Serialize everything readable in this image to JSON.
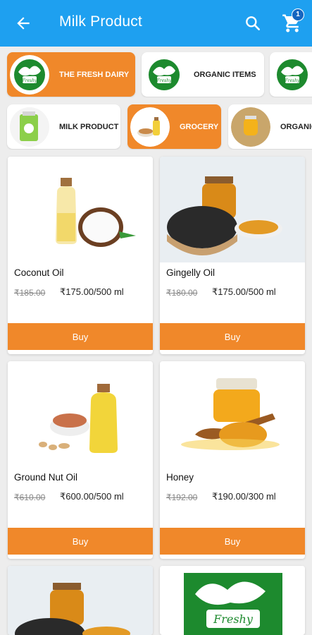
{
  "header": {
    "title": "Milk Product",
    "cart_count": "1"
  },
  "categories_row1": [
    {
      "label": "THE FRESH DAIRY",
      "active": true
    },
    {
      "label": "ORGANIC ITEMS",
      "active": false
    },
    {
      "label": "",
      "active": false
    }
  ],
  "categories_row2": [
    {
      "label": "MILK PRODUCT",
      "active": false
    },
    {
      "label": "GROCERY",
      "active": true
    },
    {
      "label": "ORGANIC",
      "active": false
    }
  ],
  "products": [
    {
      "name": "Coconut Oil",
      "old_price": "₹185.00",
      "price": "₹175.00/500 ml",
      "buy": "Buy"
    },
    {
      "name": "Gingelly Oil",
      "old_price": "₹180.00",
      "price": "₹175.00/500 ml",
      "buy": "Buy"
    },
    {
      "name": "Ground Nut Oil",
      "old_price": "₹610.00",
      "price": "₹600.00/500 ml",
      "buy": "Buy"
    },
    {
      "name": "Honey",
      "old_price": "₹192.00",
      "price": "₹190.00/300 ml",
      "buy": "Buy"
    }
  ],
  "logo_text": "Freshy",
  "colors": {
    "appbar": "#1ea0f0",
    "accent": "#f0882a",
    "background": "#ededed"
  }
}
